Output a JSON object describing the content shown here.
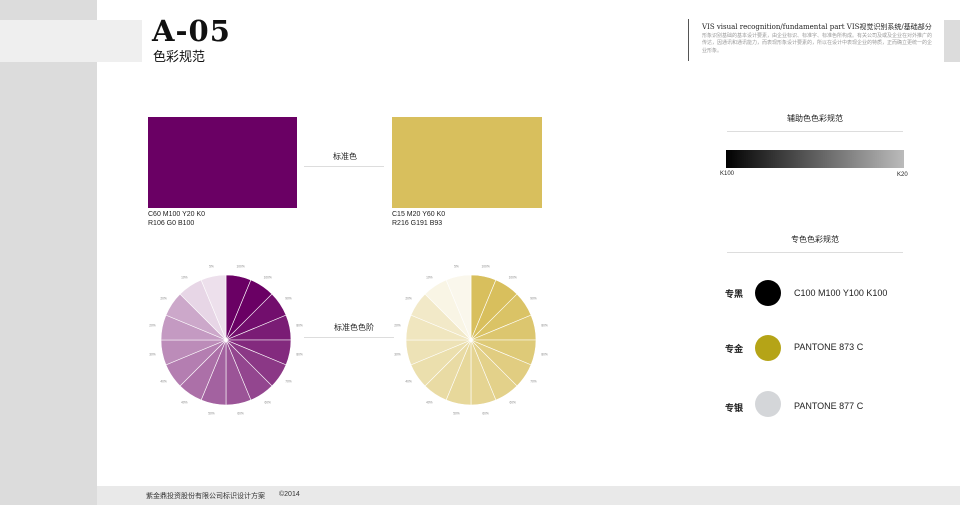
{
  "header": {
    "code": "A-05",
    "subtitle": "色彩规范",
    "title": "VIS visual recognition/fundamental part   VIS视觉识别系统/基础部分",
    "description": "形象识别基础的基本设计要素，由企业标识、标准字、标准色所构成。有关公司及或及企业在对外推广的传达，因通讯和通讯能力，而表现形象设计要素的，所以在设计中表现企业的特质，正而确立更统一的企业形象。"
  },
  "standard": {
    "label": "标准色",
    "purple": {
      "color": "#6a0064",
      "cmyk": "C60  M100  Y20  K0",
      "rgb": "R106  G0  B100"
    },
    "gold": {
      "color": "#d8bf5d",
      "cmyk": "C15  M20  Y60  K0",
      "rgb": "R216  G191  B93"
    }
  },
  "scale": {
    "label": "标准色色阶",
    "percents": [
      "100%",
      "90%",
      "80%",
      "70%",
      "60%",
      "50%",
      "40%",
      "30%",
      "20%",
      "10%",
      "5%"
    ],
    "wheel_steps": [
      "5%",
      "10%",
      "20%",
      "30%",
      "40%",
      "50%",
      "60%",
      "70%",
      "80%",
      "90%",
      "100%"
    ]
  },
  "aux": {
    "title": "辅助色色彩规范",
    "k_start": "K100",
    "k_end": "K20"
  },
  "special": {
    "title": "专色色彩规范",
    "items": [
      {
        "label": "专黑",
        "color": "#000000",
        "value": "C100    M100    Y100    K100"
      },
      {
        "label": "专金",
        "color": "#b5a417",
        "value": "PANTONE 873 C"
      },
      {
        "label": "专银",
        "color": "#d4d6d9",
        "value": "PANTONE 877 C"
      }
    ]
  },
  "footer": {
    "company": "紫金鼎投资股份有限公司标识设计方案",
    "year": "©2014"
  }
}
